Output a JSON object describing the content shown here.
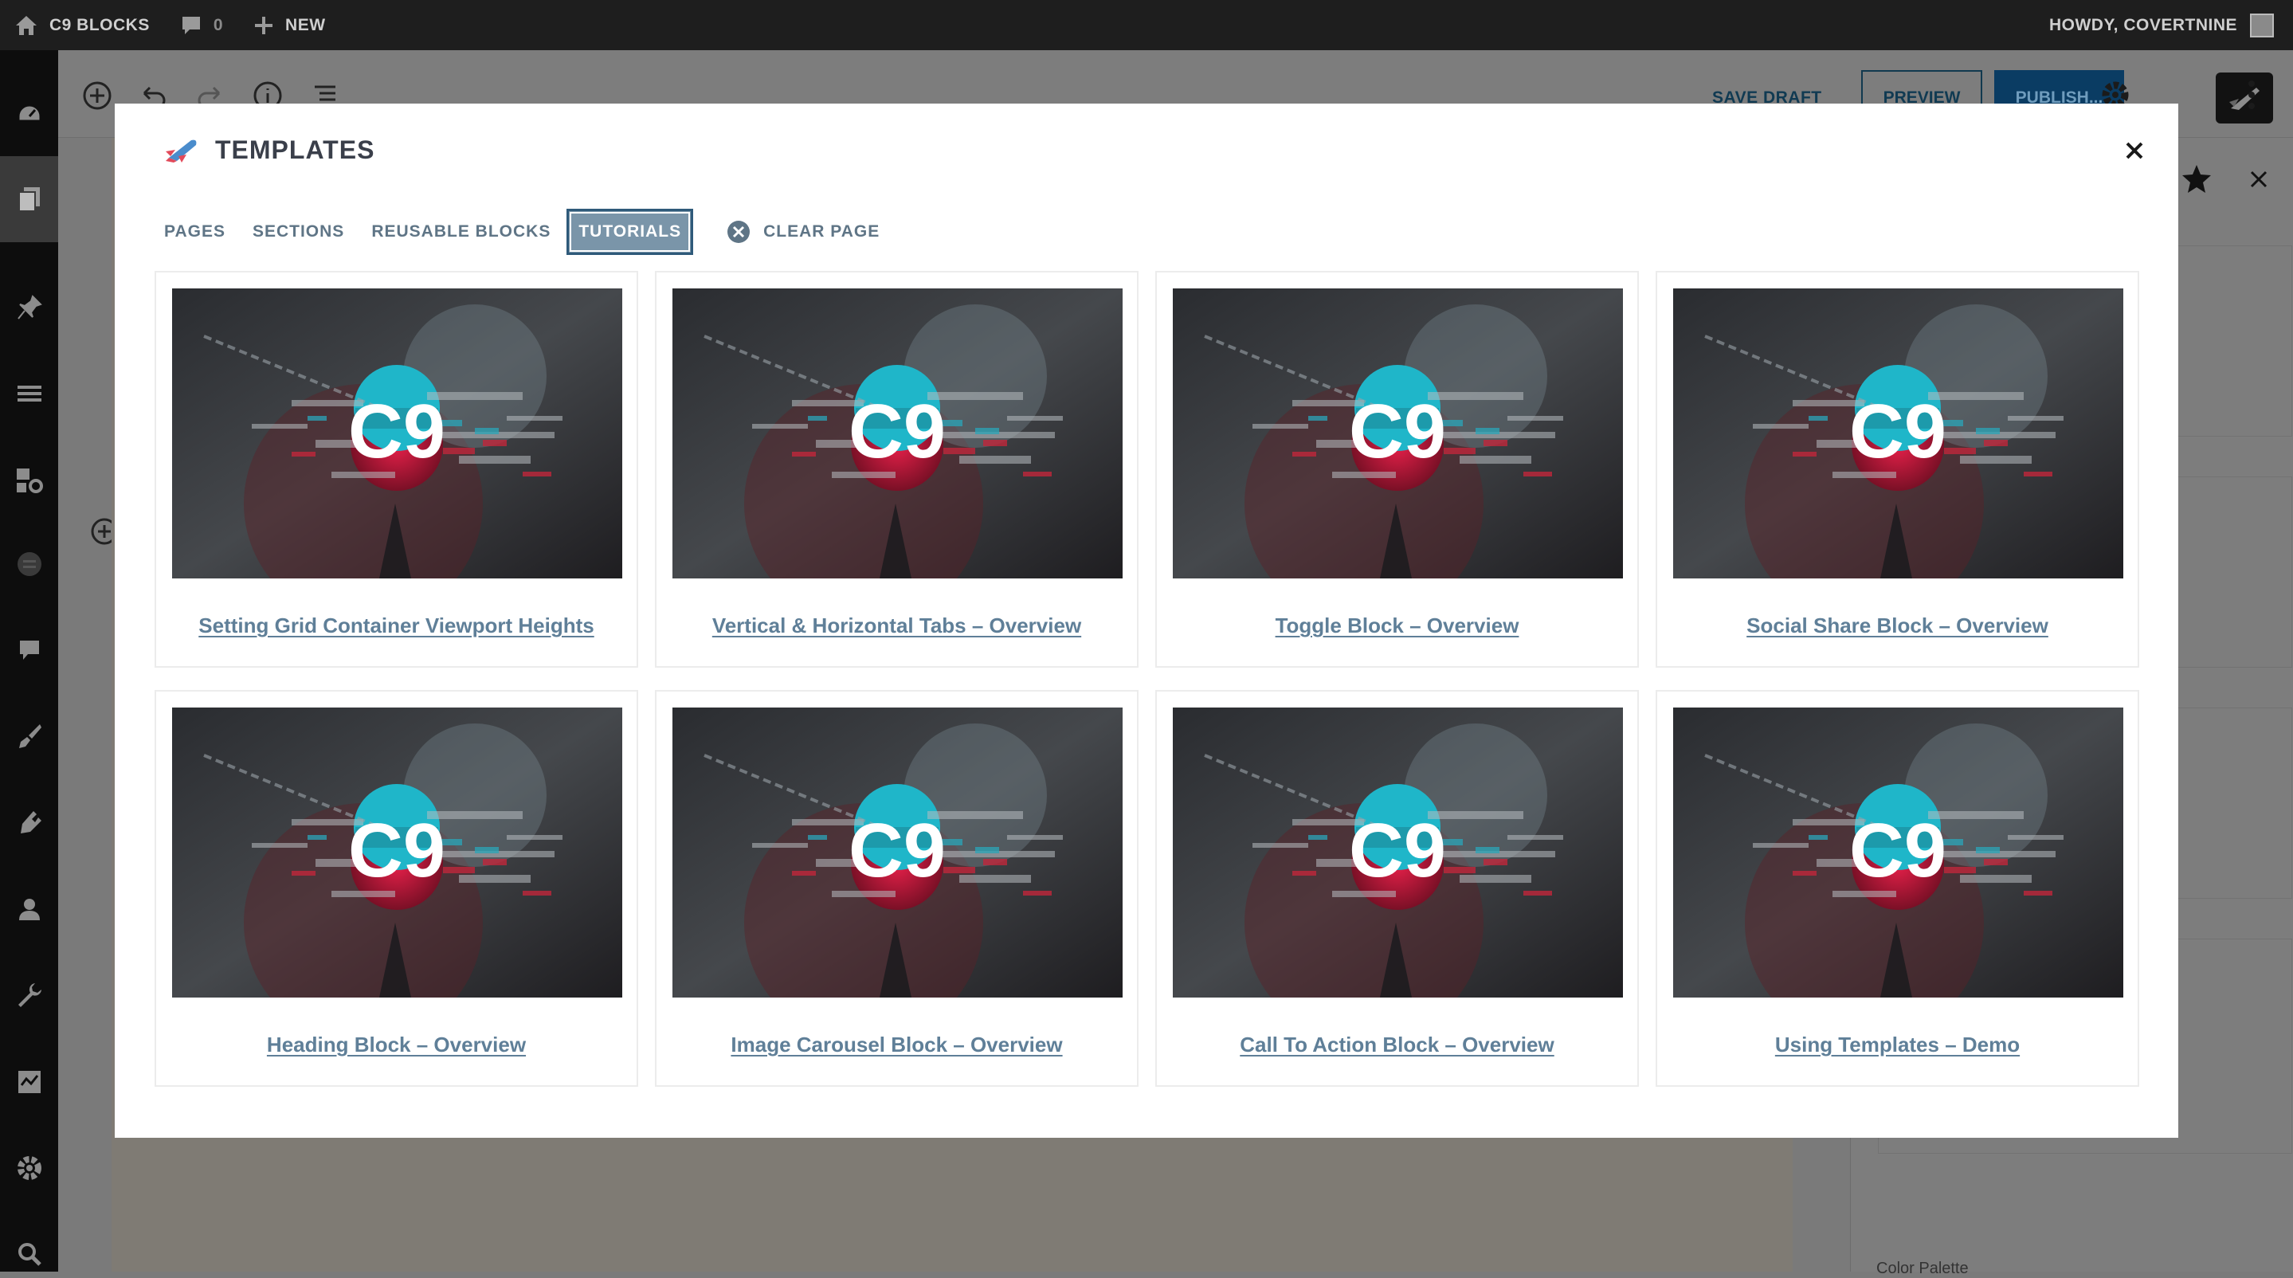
{
  "admin_bar": {
    "site_name": "C9 BLOCKS",
    "comment_count": "0",
    "new_label": "NEW",
    "greeting": "HOWDY, COVERTNINE"
  },
  "editor_toolbar": {
    "save_draft": "SAVE DRAFT",
    "preview": "PREVIEW",
    "publish": "PUBLISH..."
  },
  "settings_panel": {
    "color_palette_label": "Color Palette"
  },
  "modal": {
    "title": "TEMPLATES",
    "tabs": [
      {
        "label": "PAGES",
        "active": false
      },
      {
        "label": "SECTIONS",
        "active": false
      },
      {
        "label": "REUSABLE BLOCKS",
        "active": false
      },
      {
        "label": "TUTORIALS",
        "active": true
      }
    ],
    "clear_page": "CLEAR PAGE",
    "thumbnail_logo_text": "C9",
    "cards": [
      {
        "title": "Setting Grid Container Viewport Heights"
      },
      {
        "title": "Vertical & Horizontal Tabs – Overview"
      },
      {
        "title": "Toggle Block – Overview"
      },
      {
        "title": "Social Share Block – Overview"
      },
      {
        "title": "Heading Block – Overview"
      },
      {
        "title": "Image Carousel Block – Overview"
      },
      {
        "title": "Call To Action Block – Overview"
      },
      {
        "title": "Using Templates – Demo"
      }
    ]
  },
  "colors": {
    "admin_bar_bg": "#1e1e1e",
    "link_color": "#5f7f98",
    "active_tab_bg": "#7a95a9",
    "publish_bg": "#0a3c63"
  }
}
